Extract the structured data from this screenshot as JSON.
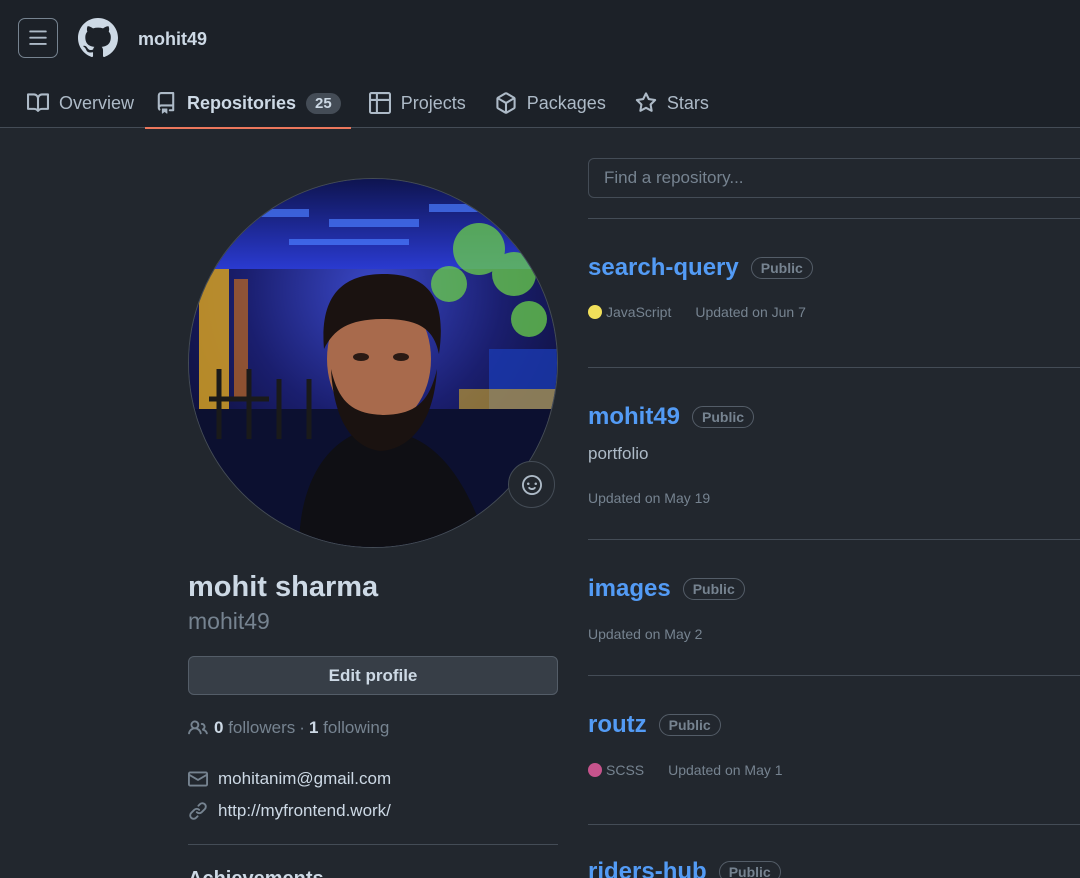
{
  "header": {
    "username": "mohit49"
  },
  "tabs": [
    {
      "label": "Overview",
      "icon": "book-icon"
    },
    {
      "label": "Repositories",
      "icon": "repo-icon",
      "count": "25",
      "active": true
    },
    {
      "label": "Projects",
      "icon": "table-icon"
    },
    {
      "label": "Packages",
      "icon": "package-icon"
    },
    {
      "label": "Stars",
      "icon": "star-icon"
    }
  ],
  "profile": {
    "fullname": "mohit sharma",
    "login": "mohit49",
    "edit_label": "Edit profile",
    "followers_count": "0",
    "followers_label": "followers",
    "separator": "·",
    "following_count": "1",
    "following_label": "following",
    "email": "mohitanim@gmail.com",
    "website": "http://myfrontend.work/",
    "achievements_heading": "Achievements"
  },
  "search": {
    "placeholder": "Find a repository..."
  },
  "repos": [
    {
      "name": "search-query",
      "visibility": "Public",
      "language": "JavaScript",
      "language_color": "#f1e05a",
      "updated": "Updated on Jun 7"
    },
    {
      "name": "mohit49",
      "visibility": "Public",
      "description": "portfolio",
      "updated": "Updated on May 19"
    },
    {
      "name": "images",
      "visibility": "Public",
      "updated": "Updated on May 2"
    },
    {
      "name": "routz",
      "visibility": "Public",
      "language": "SCSS",
      "language_color": "#c6538c",
      "updated": "Updated on May 1"
    },
    {
      "name": "riders-hub",
      "visibility": "Public"
    }
  ],
  "colors": {
    "accent_underline": "#ec775c",
    "link": "#539bf5",
    "background": "#22272e"
  }
}
